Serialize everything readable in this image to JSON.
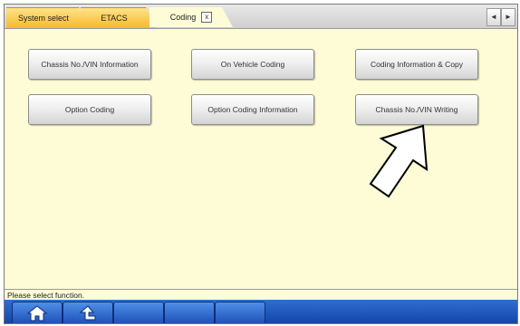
{
  "tabs": [
    {
      "label": "System select"
    },
    {
      "label": "ETACS"
    },
    {
      "label": "Coding",
      "close": "x"
    }
  ],
  "nav": {
    "prev": "◄",
    "next": "►"
  },
  "buttons": {
    "row1": [
      "Chassis No./VIN Information",
      "On Vehicle Coding",
      "Coding Information & Copy"
    ],
    "row2": [
      "Option Coding",
      "Option Coding Information",
      "Chassis No./VIN Writing"
    ]
  },
  "status_text": "Please select function.",
  "toolbar": {
    "icons": [
      "home-icon",
      "return-icon"
    ]
  },
  "colors": {
    "content_bg": "#fdfcd6",
    "tab_yellow": "#f6b92b",
    "toolbar_blue": "#1446a8"
  }
}
